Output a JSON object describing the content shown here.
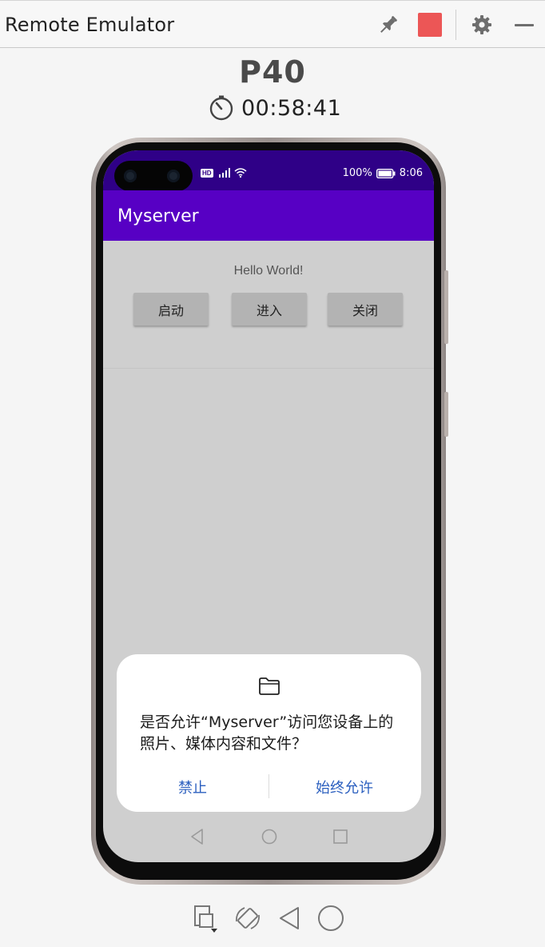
{
  "window": {
    "title": "Remote Emulator",
    "icons": {
      "pin": "pin-icon",
      "stop": "stop-icon",
      "settings": "gear-icon",
      "minimize": "minimize-icon"
    },
    "stop_color": "#ec5656"
  },
  "device": {
    "name": "P40",
    "timer": "00:58:41"
  },
  "status_bar": {
    "badge": "HD",
    "battery": "100%",
    "time": "8:06",
    "color": "#2f0087"
  },
  "app": {
    "title": "Myserver",
    "toolbar_color": "#5700c4",
    "hello": "Hello World!",
    "buttons": [
      "启动",
      "进入",
      "关闭"
    ]
  },
  "dialog": {
    "icon": "folder-icon",
    "message": "是否允许“Myserver”访问您设备上的照片、媒体内容和文件？",
    "deny_label": "禁止",
    "allow_label": "始终允许",
    "action_color": "#2b5fbf"
  },
  "nav": {
    "icons": [
      "back-icon",
      "home-icon",
      "recents-icon"
    ]
  },
  "toolbar": {
    "icons": [
      "screenshot-icon",
      "rotate-icon",
      "back-icon",
      "home-icon"
    ]
  }
}
